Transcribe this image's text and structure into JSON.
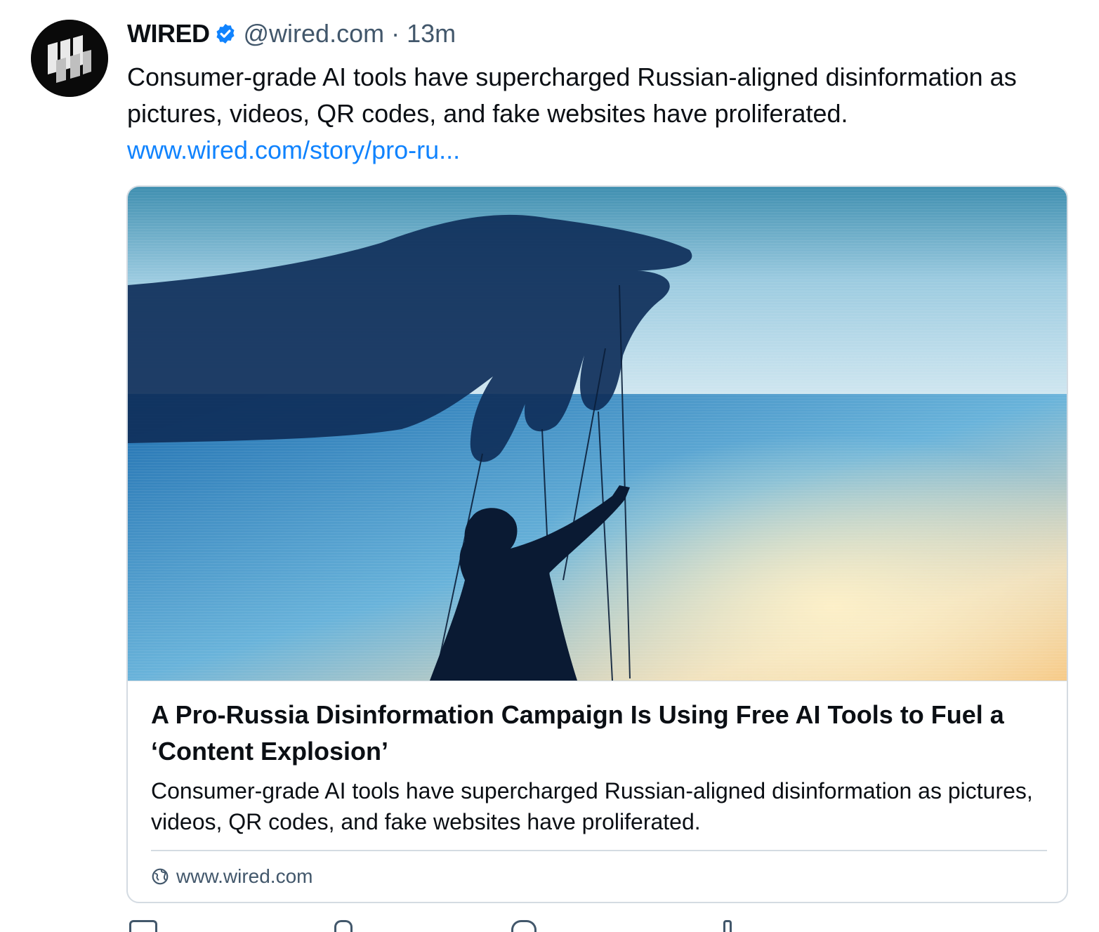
{
  "post": {
    "author": {
      "display_name": "WIRED",
      "handle": "@wired.com",
      "avatar_icon": "wired-logo-icon",
      "verified_icon": "verified-badge-icon"
    },
    "separator": "·",
    "timestamp": "13m",
    "text": "Consumer-grade AI tools have supercharged Russian-aligned disinformation as pictures, videos, QR codes, and fake websites have proliferated.",
    "link_text": "www.wired.com/story/pro-ru..."
  },
  "card": {
    "image_icon": "puppeteer-hand-illustration",
    "title": "A Pro-Russia Disinformation Campaign Is Using Free AI Tools to Fuel a ‘Content Explosion’",
    "description": "Consumer-grade AI tools have supercharged Russian-aligned disinformation as pictures, videos, QR codes, and fake websites have proliferated.",
    "domain_icon": "globe-icon",
    "domain": "www.wired.com"
  },
  "colors": {
    "link": "#1083fe",
    "muted": "#42576b",
    "border": "#d4dbe2"
  },
  "actions": [
    "reply-icon",
    "repost-icon",
    "like-icon",
    "more-icon"
  ]
}
